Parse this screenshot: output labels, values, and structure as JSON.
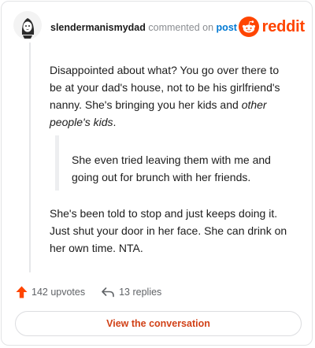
{
  "comment": {
    "username": "slendermanismydad",
    "action_text": "commented on",
    "post_link": "post",
    "brand": "reddit",
    "paragraph1_plain": "Disappointed about what? You go over there to be at your dad's house, not to be his girlfriend's nanny. She's bringing you her kids and ",
    "paragraph1_italic": "other people's kids",
    "paragraph1_end": ".",
    "quote": "She even tried leaving them with me and going out for brunch with her friends.",
    "paragraph3": "She's been told to stop and just keeps doing it. Just shut your door in her face. She can drink on her own time. NTA."
  },
  "actions": {
    "upvotes": "142 upvotes",
    "replies": "13 replies"
  },
  "cta": {
    "label": "View the conversation"
  },
  "colors": {
    "reddit_orange": "#ff4500",
    "link_blue": "#0079d3",
    "cta_text": "#d14117"
  },
  "icons": {
    "avatar": "user-avatar",
    "brand": "reddit-snoo-icon",
    "upvote": "upvote-arrow-icon",
    "reply": "reply-arrow-icon"
  }
}
